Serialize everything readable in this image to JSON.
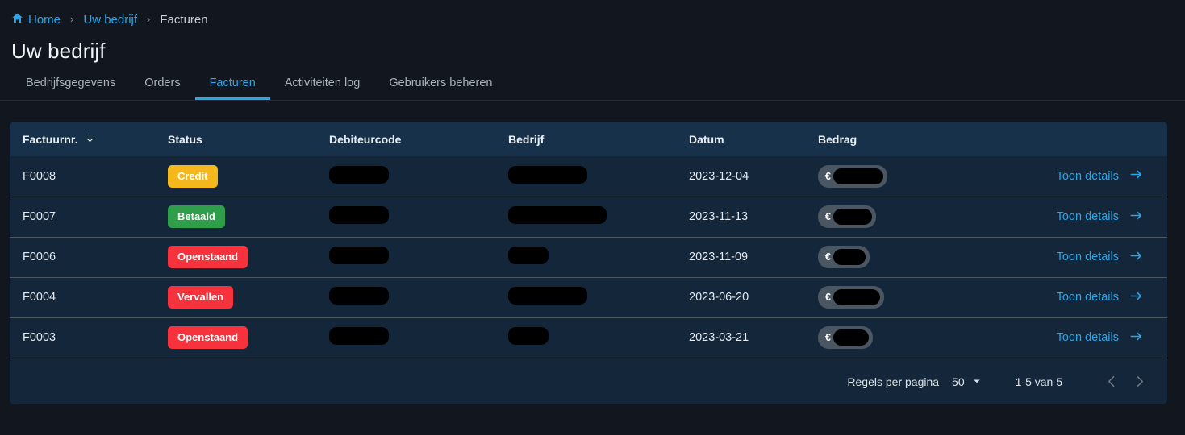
{
  "breadcrumb": {
    "home_icon": "home-icon",
    "items": [
      {
        "label": "Home",
        "type": "link"
      },
      {
        "label": "Uw bedrijf",
        "type": "link"
      },
      {
        "label": "Facturen",
        "type": "current"
      }
    ],
    "separator": "›"
  },
  "page": {
    "title": "Uw bedrijf"
  },
  "tabs": [
    {
      "label": "Bedrijfsgegevens",
      "active": false
    },
    {
      "label": "Orders",
      "active": false
    },
    {
      "label": "Facturen",
      "active": true
    },
    {
      "label": "Activiteiten log",
      "active": false
    },
    {
      "label": "Gebruikers beheren",
      "active": false
    }
  ],
  "table": {
    "columns": [
      {
        "label": "Factuurnr.",
        "sort_icon": "arrow-down-icon",
        "sorted": true
      },
      {
        "label": "Status",
        "sorted": false
      },
      {
        "label": "Debiteurcode",
        "sorted": false
      },
      {
        "label": "Bedrijf",
        "sorted": false
      },
      {
        "label": "Datum",
        "sorted": false
      },
      {
        "label": "Bedrag",
        "sorted": false
      },
      {
        "label": "",
        "sorted": false
      }
    ],
    "action_label": "Toon details",
    "action_icon": "arrow-right-icon",
    "currency_symbol": "€",
    "rows": [
      {
        "factuurnr": "F0008",
        "status": "Credit",
        "status_kind": "credit",
        "debiteurcode_redacted_width": 74,
        "bedrijf_redacted_width": 98,
        "datum": "2023-12-04",
        "bedrag_redacted_width": 62
      },
      {
        "factuurnr": "F0007",
        "status": "Betaald",
        "status_kind": "betaald",
        "debiteurcode_redacted_width": 74,
        "bedrijf_redacted_width": 122,
        "datum": "2023-11-13",
        "bedrag_redacted_width": 48
      },
      {
        "factuurnr": "F0006",
        "status": "Openstaand",
        "status_kind": "openstaand",
        "debiteurcode_redacted_width": 74,
        "bedrijf_redacted_width": 50,
        "datum": "2023-11-09",
        "bedrag_redacted_width": 40
      },
      {
        "factuurnr": "F0004",
        "status": "Vervallen",
        "status_kind": "vervallen",
        "debiteurcode_redacted_width": 74,
        "bedrijf_redacted_width": 98,
        "datum": "2023-06-20",
        "bedrag_redacted_width": 58
      },
      {
        "factuurnr": "F0003",
        "status": "Openstaand",
        "status_kind": "openstaand",
        "debiteurcode_redacted_width": 74,
        "bedrijf_redacted_width": 50,
        "datum": "2023-03-21",
        "bedrag_redacted_width": 44
      }
    ]
  },
  "pagination": {
    "rows_per_page_label": "Regels per pagina",
    "rows_per_page_value": "50",
    "dropdown_icon": "chevron-down-icon",
    "range_label": "1-5 van 5",
    "prev_icon": "chevron-left-icon",
    "next_icon": "chevron-right-icon",
    "prev_enabled": false,
    "next_enabled": false
  },
  "colors": {
    "accent": "#2ba7e8",
    "page_background": "#12161f",
    "card_background": "#14263a",
    "header_background": "#17314a",
    "status_credit": "#f5b81c",
    "status_betaald": "#2e9e4b",
    "status_openstaand": "#f6333c",
    "status_vervallen": "#f6333c",
    "redaction": "#000000",
    "amount_pill": "#4a5662"
  }
}
